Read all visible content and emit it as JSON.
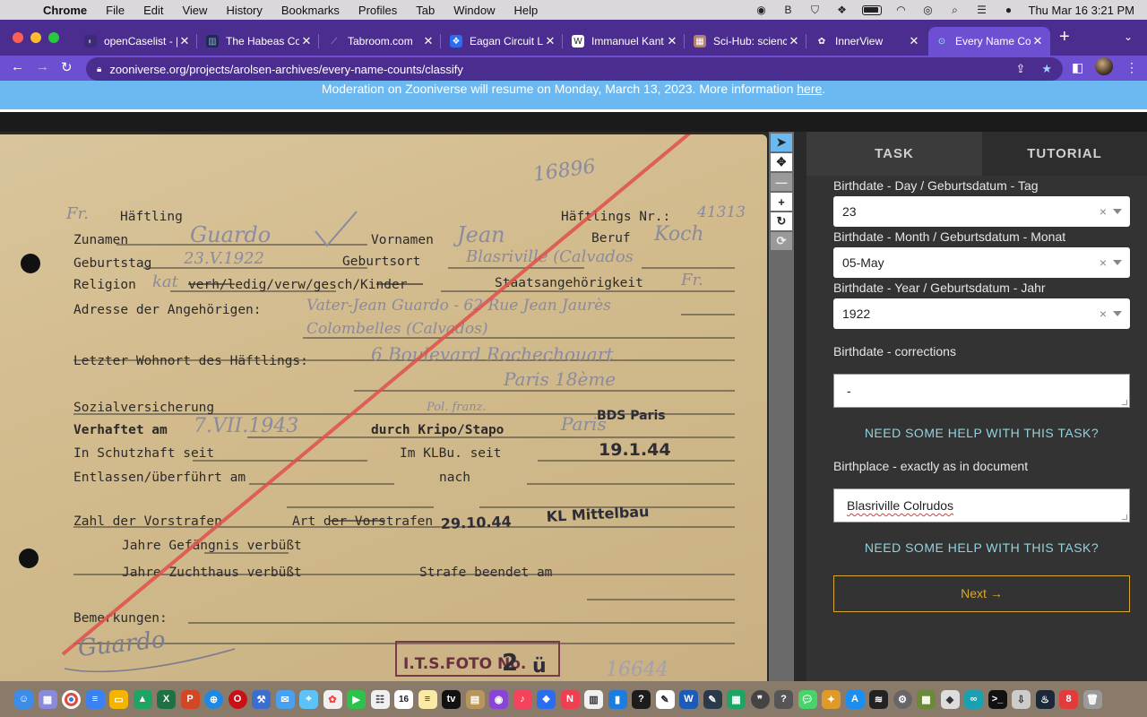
{
  "menubar": {
    "app": "Chrome",
    "items": [
      "File",
      "Edit",
      "View",
      "History",
      "Bookmarks",
      "Profiles",
      "Tab",
      "Window",
      "Help"
    ],
    "clock": "Thu Mar 16  3:21 PM"
  },
  "tabs": [
    {
      "title": "openCaselist - |",
      "active": false
    },
    {
      "title": "The Habeas Co",
      "active": false
    },
    {
      "title": "Tabroom.com",
      "active": false
    },
    {
      "title": "Eagan Circuit LI",
      "active": false
    },
    {
      "title": "Immanuel Kant",
      "active": false
    },
    {
      "title": "Sci-Hub: scienc",
      "active": false
    },
    {
      "title": "InnerView",
      "active": false
    },
    {
      "title": "Every Name Co",
      "active": true
    }
  ],
  "address": {
    "url": "zooniverse.org/projects/arolsen-archives/every-name-counts/classify"
  },
  "banner": {
    "text": "Moderation on Zooniverse will resume on Monday, March 13, 2023. More information ",
    "link": "here",
    "suffix": "."
  },
  "document": {
    "number_top": "16896",
    "number_bottom": "16644",
    "prefix_fr": "Fr.",
    "haeftling": "Häftling",
    "haeftlings_nr_label": "Häftlings Nr.:",
    "haeftlings_nr": "41313",
    "zuname_label": "Zunamen",
    "zuname": "Guardo",
    "vorname_label": "Vornamen",
    "vorname": "Jean",
    "beruf_label": "Beruf",
    "beruf": "Koch",
    "geburtstag_label": "Geburtstag",
    "geburtstag": "23.V.1922",
    "geburtsort_label": "Geburtsort",
    "geburtsort": "Blasriville (Calvados",
    "religion_label": "Religion",
    "religion": "kat",
    "religion_options": "verh/ledig/verw/gesch/Kinder",
    "staats_label": "Staatsangehörigkeit",
    "staats": "Fr.",
    "adresse_label": "Adresse der Angehörigen:",
    "adresse_1": "Vater-Jean Guardo - 62 Rue Jean Jaurès",
    "adresse_2": "Colombelles (Calvados)",
    "wohnort_label": "Letzter Wohnort des Häftlings:",
    "wohnort_1": "6 Boulevard Rochechouart",
    "wohnort_2": "Paris 18ème",
    "sozial_label": "Sozialversicherung",
    "verhaftet_label": "Verhaftet am",
    "verhaftet": "7.VII.1943",
    "durch_label": "durch Kripo/Stapo",
    "durch_note": "Pol. franz.",
    "bds": "BDS Paris",
    "durch_city": "Paris",
    "schutzhaft_label": "In Schutzhaft seit",
    "klbu_label": "Im KLBu. seit",
    "klbu_date": "19.1.44",
    "entlassen_label": "Entlassen/überführt am",
    "nach_label": "nach",
    "vorstrafen_label": "Zahl der Vorstrafen",
    "art_label": "Art der Vorstrafen",
    "stamp_date": "29.10.44",
    "stamp_kl": "KL Mittelbau",
    "gefaengnis_label": "Jahre Gefängnis verbüßt",
    "zuchthaus_label": "Jahre Zuchthaus verbüßt",
    "strafe_label": "Strafe beendet am",
    "bemerkungen_label": "Bemerkungen:",
    "signature": "Guardo",
    "foto_stamp": "I.T.S.FOTO No.",
    "foto_no": "2",
    "foto_sub": "ü"
  },
  "tools": [
    "pointer",
    "move",
    "zoom-out",
    "zoom-in",
    "rotate",
    "reset"
  ],
  "panel": {
    "tab_task": "TASK",
    "tab_tutorial": "TUTORIAL",
    "day_label": "Birthdate - Day / Geburtsdatum - Tag",
    "day_value": "23",
    "month_label": "Birthdate - Month / Geburtsdatum - Monat",
    "month_value": "05-May",
    "year_label": "Birthdate - Year / Geburtsdatum - Jahr",
    "year_value": "1922",
    "corrections_label": "Birthdate - corrections",
    "corrections_value": "-",
    "help_1": "NEED SOME HELP WITH THIS TASK?",
    "birthplace_label": "Birthplace - exactly as in document",
    "birthplace_value": "Blasriville Colrudos",
    "help_2": "NEED SOME HELP WITH THIS TASK?",
    "next_label": "Next",
    "next_arrow": "→",
    "clear_symbol": "×"
  },
  "dock": {
    "calendar_day": "16",
    "badge_count": "8"
  },
  "colors": {
    "tab_strip": "#4a2d8f",
    "toolbar": "#6d4fd1",
    "banner": "#6cb8f0",
    "panel": "#333333",
    "next_border": "#d7a830",
    "help_link": "#8fd4e0",
    "red_line": "#e0504c"
  }
}
